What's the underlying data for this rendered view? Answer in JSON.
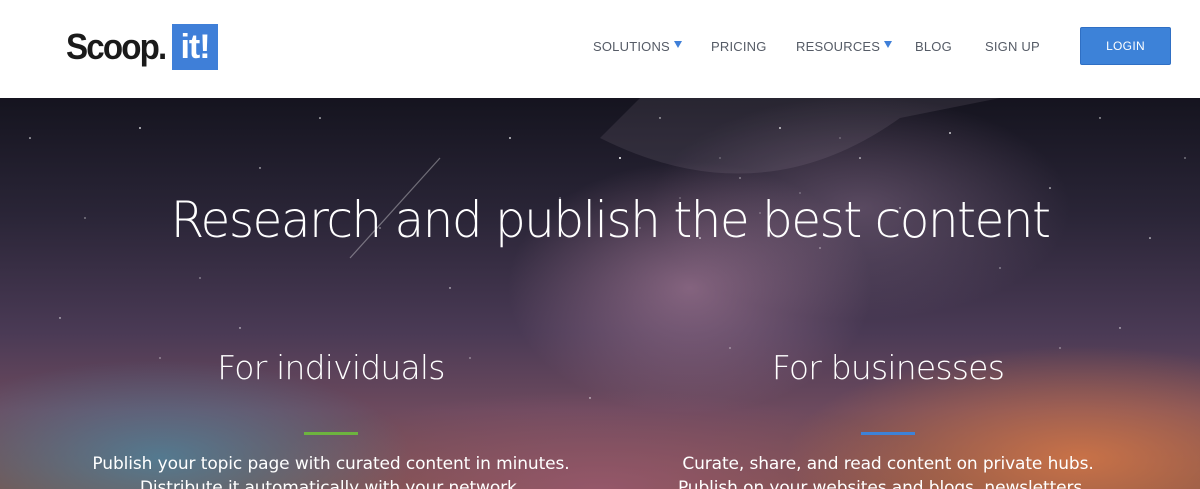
{
  "brand": {
    "logo_word": "Scoop.",
    "logo_box": "it!",
    "accent_color": "#3f7fd8"
  },
  "nav": {
    "items": [
      {
        "label": "SOLUTIONS",
        "has_dropdown": true
      },
      {
        "label": "PRICING",
        "has_dropdown": false
      },
      {
        "label": "RESOURCES",
        "has_dropdown": true
      },
      {
        "label": "BLOG",
        "has_dropdown": false
      },
      {
        "label": "SIGN UP",
        "has_dropdown": false
      }
    ],
    "login_label": "LOGIN"
  },
  "hero": {
    "title": "Research and publish the best content",
    "individuals": {
      "title": "For individuals",
      "accent": "#6db33f",
      "line1": "Publish your topic page with curated content in minutes.",
      "line2": "Distribute it automatically with your network."
    },
    "businesses": {
      "title": "For businesses",
      "accent": "#3d82d8",
      "line1": "Curate, share, and read content on private hubs.",
      "line2": "Publish on your websites and blogs, newsletters..."
    }
  }
}
